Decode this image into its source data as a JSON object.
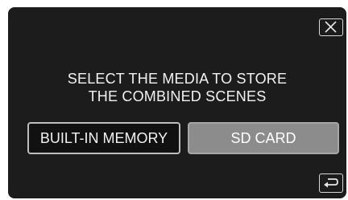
{
  "dialog": {
    "message_line1": "SELECT THE MEDIA TO STORE",
    "message_line2": "THE COMBINED SCENES"
  },
  "options": {
    "built_in_label": "BUILT-IN MEMORY",
    "sd_card_label": "SD CARD",
    "selected": "SD CARD"
  },
  "icons": {
    "close": "close-icon",
    "back": "back-icon"
  },
  "colors": {
    "background": "#1c1c1c",
    "text": "#f2f2f2",
    "selected_button": "#8c8c8c",
    "unselected_button": "#111111"
  }
}
